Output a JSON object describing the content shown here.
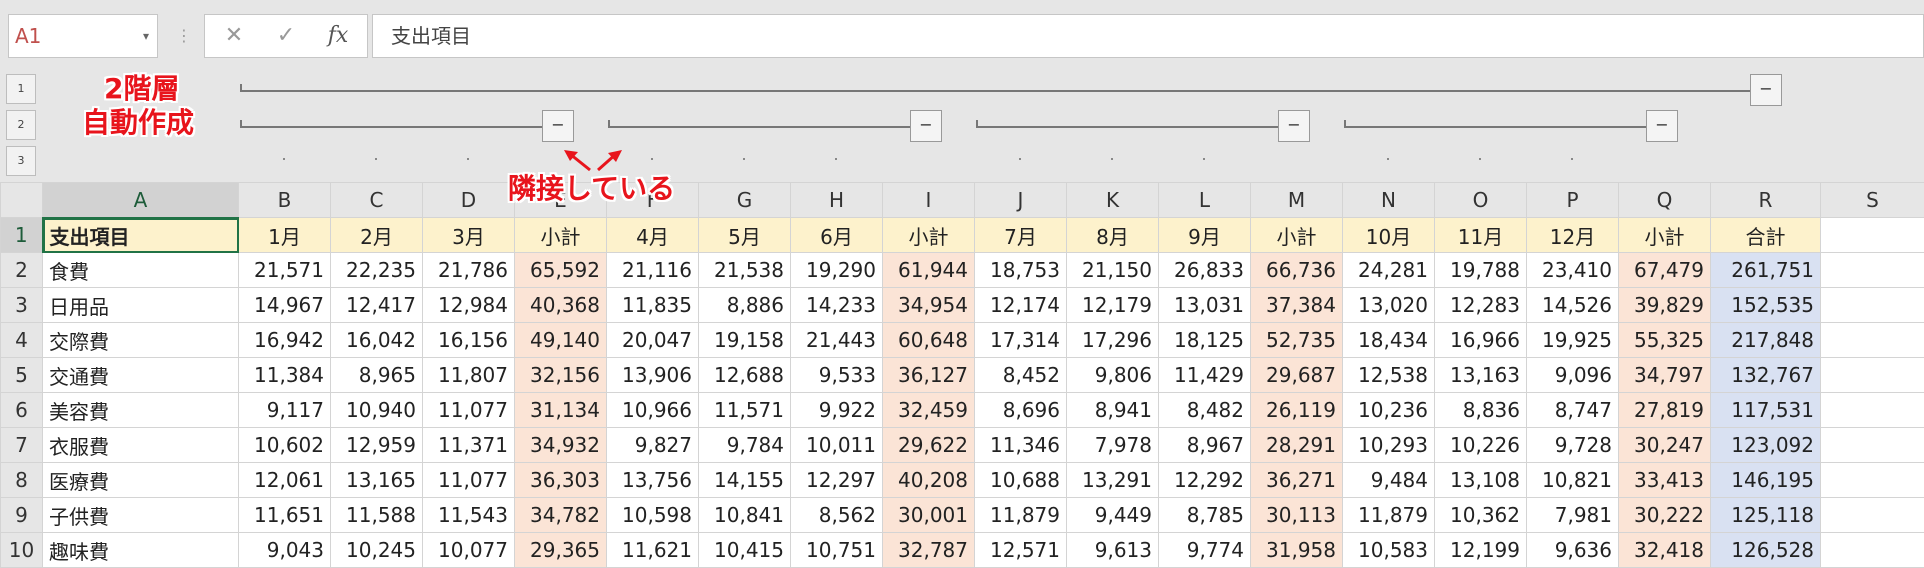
{
  "formula_bar": {
    "name_box": "A1",
    "cancel_icon": "✕",
    "enter_icon": "✓",
    "fx_label": "fx",
    "content": "支出項目"
  },
  "outline": {
    "levels": [
      "1",
      "2",
      "3"
    ],
    "collapse_label": "−"
  },
  "annotations": {
    "auto_create_line1": "2階層",
    "auto_create_line2": "自動作成",
    "adjacent": "隣接している"
  },
  "grid": {
    "columns": [
      "A",
      "B",
      "C",
      "D",
      "E",
      "F",
      "G",
      "H",
      "I",
      "J",
      "K",
      "L",
      "M",
      "N",
      "O",
      "P",
      "Q",
      "R",
      "S"
    ],
    "header_row": [
      "支出項目",
      "1月",
      "2月",
      "3月",
      "小計",
      "4月",
      "5月",
      "6月",
      "小計",
      "7月",
      "8月",
      "9月",
      "小計",
      "10月",
      "11月",
      "12月",
      "小計",
      "合計"
    ],
    "rows": [
      {
        "num": "2",
        "label": "食費",
        "values": [
          "21,571",
          "22,235",
          "21,786",
          "65,592",
          "21,116",
          "21,538",
          "19,290",
          "61,944",
          "18,753",
          "21,150",
          "26,833",
          "66,736",
          "24,281",
          "19,788",
          "23,410",
          "67,479",
          "261,751"
        ]
      },
      {
        "num": "3",
        "label": "日用品",
        "values": [
          "14,967",
          "12,417",
          "12,984",
          "40,368",
          "11,835",
          "8,886",
          "14,233",
          "34,954",
          "12,174",
          "12,179",
          "13,031",
          "37,384",
          "13,020",
          "12,283",
          "14,526",
          "39,829",
          "152,535"
        ]
      },
      {
        "num": "4",
        "label": "交際費",
        "values": [
          "16,942",
          "16,042",
          "16,156",
          "49,140",
          "20,047",
          "19,158",
          "21,443",
          "60,648",
          "17,314",
          "17,296",
          "18,125",
          "52,735",
          "18,434",
          "16,966",
          "19,925",
          "55,325",
          "217,848"
        ]
      },
      {
        "num": "5",
        "label": "交通費",
        "values": [
          "11,384",
          "8,965",
          "11,807",
          "32,156",
          "13,906",
          "12,688",
          "9,533",
          "36,127",
          "8,452",
          "9,806",
          "11,429",
          "29,687",
          "12,538",
          "13,163",
          "9,096",
          "34,797",
          "132,767"
        ]
      },
      {
        "num": "6",
        "label": "美容費",
        "values": [
          "9,117",
          "10,940",
          "11,077",
          "31,134",
          "10,966",
          "11,571",
          "9,922",
          "32,459",
          "8,696",
          "8,941",
          "8,482",
          "26,119",
          "10,236",
          "8,836",
          "8,747",
          "27,819",
          "117,531"
        ]
      },
      {
        "num": "7",
        "label": "衣服費",
        "values": [
          "10,602",
          "12,959",
          "11,371",
          "34,932",
          "9,827",
          "9,784",
          "10,011",
          "29,622",
          "11,346",
          "7,978",
          "8,967",
          "28,291",
          "10,293",
          "10,226",
          "9,728",
          "30,247",
          "123,092"
        ]
      },
      {
        "num": "8",
        "label": "医療費",
        "values": [
          "12,061",
          "13,165",
          "11,077",
          "36,303",
          "13,756",
          "14,155",
          "12,297",
          "40,208",
          "10,688",
          "13,291",
          "12,292",
          "36,271",
          "9,484",
          "13,108",
          "10,821",
          "33,413",
          "146,195"
        ]
      },
      {
        "num": "9",
        "label": "子供費",
        "values": [
          "11,651",
          "11,588",
          "11,543",
          "34,782",
          "10,598",
          "10,841",
          "8,562",
          "30,001",
          "11,879",
          "9,449",
          "8,785",
          "30,113",
          "11,879",
          "10,362",
          "7,981",
          "30,222",
          "125,118"
        ]
      },
      {
        "num": "10",
        "label": "趣味費",
        "values": [
          "9,043",
          "10,245",
          "10,077",
          "29,365",
          "11,621",
          "10,415",
          "10,751",
          "32,787",
          "12,571",
          "9,613",
          "9,774",
          "31,958",
          "10,583",
          "12,199",
          "9,636",
          "32,418",
          "126,528"
        ]
      }
    ]
  }
}
